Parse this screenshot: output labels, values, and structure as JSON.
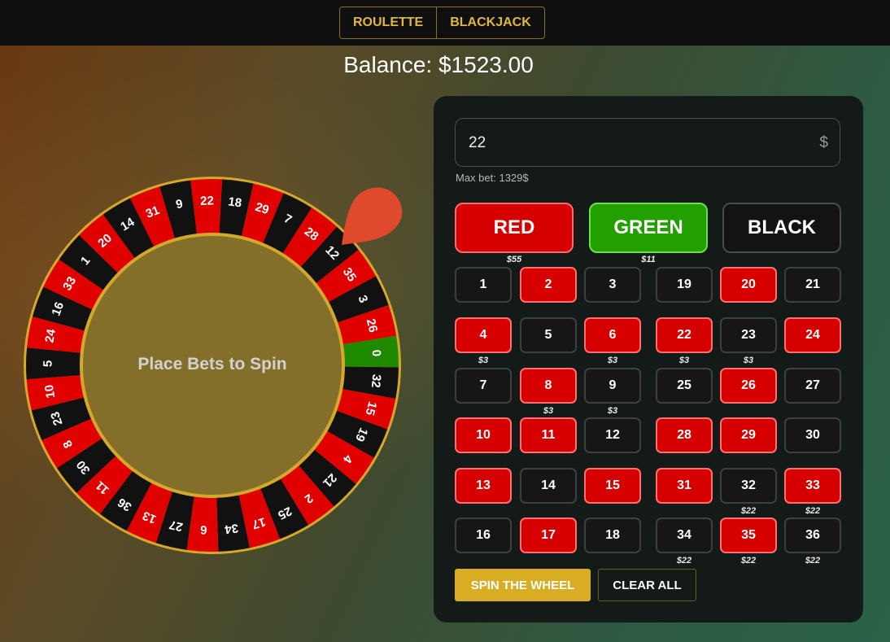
{
  "tabs": [
    {
      "label": "ROULETTE"
    },
    {
      "label": "BLACKJACK"
    }
  ],
  "balance_text": "Balance: $1523.00",
  "wheel": {
    "center_text": "Place Bets to Spin",
    "numbers": [
      0,
      32,
      15,
      19,
      4,
      21,
      2,
      25,
      17,
      34,
      6,
      27,
      13,
      36,
      11,
      30,
      8,
      23,
      10,
      5,
      24,
      16,
      33,
      1,
      20,
      14,
      31,
      9,
      22,
      18,
      29,
      7,
      28,
      12,
      35,
      3,
      26
    ],
    "colors": {
      "red": "#e00000",
      "black": "#111111",
      "green": "#1f8a00",
      "rim": "#d4a82a",
      "pointer": "#e04a2c"
    }
  },
  "bet_amount": {
    "value": "22",
    "currency": "$",
    "max_bet_text": "Max bet: 1329$"
  },
  "color_bets": [
    {
      "label": "RED",
      "style": "red",
      "bet": "$55"
    },
    {
      "label": "GREEN",
      "style": "green",
      "bet": "$11"
    },
    {
      "label": "BLACK",
      "style": "black",
      "bet": ""
    }
  ],
  "number_grid": [
    {
      "n": "1",
      "color": "black",
      "bet": ""
    },
    {
      "n": "2",
      "color": "red",
      "bet": ""
    },
    {
      "n": "3",
      "color": "black",
      "bet": ""
    },
    {
      "n": "19",
      "color": "black",
      "bet": ""
    },
    {
      "n": "20",
      "color": "red",
      "bet": ""
    },
    {
      "n": "21",
      "color": "black",
      "bet": ""
    },
    {
      "n": "4",
      "color": "red",
      "bet": "$3"
    },
    {
      "n": "5",
      "color": "black",
      "bet": ""
    },
    {
      "n": "6",
      "color": "red",
      "bet": "$3"
    },
    {
      "n": "22",
      "color": "red",
      "bet": "$3"
    },
    {
      "n": "23",
      "color": "black",
      "bet": "$3"
    },
    {
      "n": "24",
      "color": "red",
      "bet": ""
    },
    {
      "n": "7",
      "color": "black",
      "bet": ""
    },
    {
      "n": "8",
      "color": "red",
      "bet": "$3"
    },
    {
      "n": "9",
      "color": "black",
      "bet": "$3"
    },
    {
      "n": "25",
      "color": "black",
      "bet": ""
    },
    {
      "n": "26",
      "color": "red",
      "bet": ""
    },
    {
      "n": "27",
      "color": "black",
      "bet": ""
    },
    {
      "n": "10",
      "color": "red",
      "bet": ""
    },
    {
      "n": "11",
      "color": "red",
      "bet": ""
    },
    {
      "n": "12",
      "color": "black",
      "bet": ""
    },
    {
      "n": "28",
      "color": "red",
      "bet": ""
    },
    {
      "n": "29",
      "color": "red",
      "bet": ""
    },
    {
      "n": "30",
      "color": "black",
      "bet": ""
    },
    {
      "n": "13",
      "color": "red",
      "bet": ""
    },
    {
      "n": "14",
      "color": "black",
      "bet": ""
    },
    {
      "n": "15",
      "color": "red",
      "bet": ""
    },
    {
      "n": "31",
      "color": "red",
      "bet": ""
    },
    {
      "n": "32",
      "color": "black",
      "bet": "$22"
    },
    {
      "n": "33",
      "color": "red",
      "bet": "$22"
    },
    {
      "n": "16",
      "color": "black",
      "bet": ""
    },
    {
      "n": "17",
      "color": "red",
      "bet": ""
    },
    {
      "n": "18",
      "color": "black",
      "bet": ""
    },
    {
      "n": "34",
      "color": "black",
      "bet": "$22"
    },
    {
      "n": "35",
      "color": "red",
      "bet": "$22"
    },
    {
      "n": "36",
      "color": "black",
      "bet": "$22"
    }
  ],
  "actions": {
    "spin_label": "SPIN THE WHEEL",
    "clear_label": "CLEAR ALL"
  }
}
